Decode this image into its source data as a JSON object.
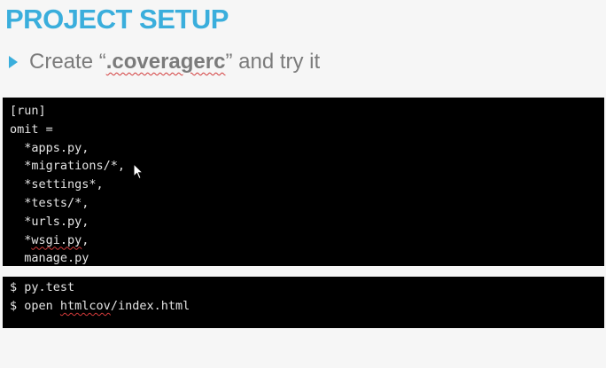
{
  "slide": {
    "title": "PROJECT SETUP",
    "bullet": {
      "prefix": "Create “",
      "emphasis": ".coveragerc",
      "suffix": "” and try it"
    }
  },
  "config_panel": {
    "lines": [
      "[run]",
      "omit =",
      "  *apps.py,",
      "  *migrations/*,",
      "  *settings*,",
      "  *tests/*,",
      "  *urls.py,",
      "  ",
      "  manage.py"
    ],
    "wsgi_line": {
      "indent": "  *",
      "flagged": "wsgi.py",
      "rest": ","
    }
  },
  "command_panel": {
    "line1": "$ py.test",
    "line2": {
      "prefix": "$ open ",
      "flagged": "htmlcov",
      "rest": "/index.html"
    }
  },
  "icons": {
    "bullet": "triangle-bullet-icon",
    "cursor": "mouse-pointer-icon"
  },
  "colors": {
    "background": "#f6f6f6",
    "title": "#3aaedc",
    "bullet": "#3aaedc",
    "body_text": "#7b7b7b",
    "code_panel": "#000000",
    "code_text": "#e4e4e4",
    "spellcheck_underline": "#d23a3a"
  }
}
